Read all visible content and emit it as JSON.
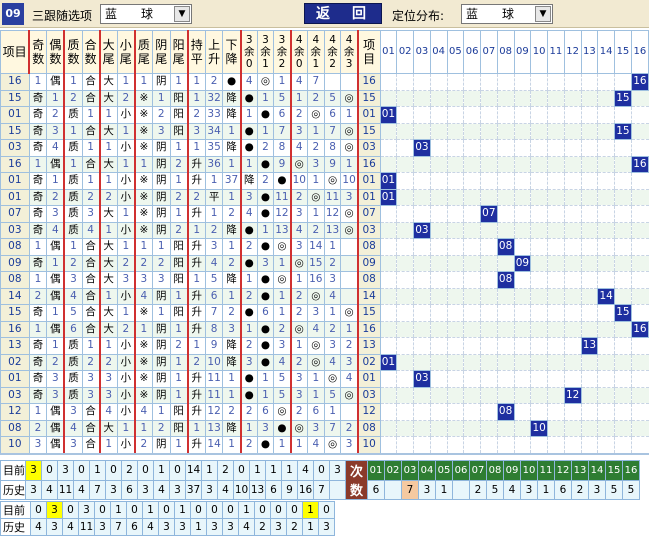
{
  "header": {
    "issue": "09",
    "follow_label": "三跟随选项",
    "follow_value": "蓝　　球",
    "back_label": "返　回",
    "position_label": "定位分布:",
    "position_value": "蓝　　球"
  },
  "columns": [
    "项目",
    "奇数",
    "偶数",
    "质数",
    "合数",
    "大尾",
    "小尾",
    "质尾",
    "阴尾",
    "阳尾",
    "持平",
    "上升",
    "下降",
    "3余0",
    "3余1",
    "3余2",
    "4余0",
    "4余1",
    "4余2",
    "4余3",
    "项目"
  ],
  "num_columns": [
    "01",
    "02",
    "03",
    "04",
    "05",
    "06",
    "07",
    "08",
    "09",
    "10",
    "11",
    "12",
    "13",
    "14",
    "15",
    "16"
  ],
  "rows": [
    {
      "n": "16",
      "c": [
        "1",
        "偶",
        "1",
        "合",
        "大",
        "1",
        "1",
        "阴",
        "1",
        "1",
        "2",
        "●",
        "4",
        "◎",
        "1",
        "4",
        "7"
      ]
    },
    {
      "n": "15",
      "c": [
        "奇",
        "1",
        "2",
        "合",
        "大",
        "2",
        "※",
        "1",
        "阳",
        "1",
        "32",
        "降",
        "●",
        "1",
        "5",
        "1",
        "2",
        "5",
        "◎"
      ]
    },
    {
      "n": "01",
      "c": [
        "奇",
        "2",
        "质",
        "1",
        "1",
        "小",
        "※",
        "2",
        "阳",
        "2",
        "33",
        "降",
        "1",
        "●",
        "6",
        "2",
        "◎",
        "6",
        "1"
      ]
    },
    {
      "n": "15",
      "c": [
        "奇",
        "3",
        "1",
        "合",
        "大",
        "1",
        "※",
        "3",
        "阳",
        "3",
        "34",
        "1",
        "●",
        "1",
        "7",
        "3",
        "1",
        "7",
        "◎"
      ]
    },
    {
      "n": "03",
      "c": [
        "奇",
        "4",
        "质",
        "1",
        "1",
        "小",
        "※",
        "阴",
        "1",
        "1",
        "35",
        "降",
        "●",
        "2",
        "8",
        "4",
        "2",
        "8",
        "◎"
      ]
    },
    {
      "n": "16",
      "c": [
        "1",
        "偶",
        "1",
        "合",
        "大",
        "1",
        "1",
        "阴",
        "2",
        "升",
        "36",
        "1",
        "1",
        "●",
        "9",
        "◎",
        "3",
        "9",
        "1"
      ]
    },
    {
      "n": "01",
      "c": [
        "奇",
        "1",
        "质",
        "1",
        "1",
        "小",
        "※",
        "阴",
        "1",
        "升",
        "1",
        "37",
        "降",
        "2",
        "●",
        "10",
        "1",
        "◎",
        "10",
        "2"
      ]
    },
    {
      "n": "01",
      "c": [
        "奇",
        "2",
        "质",
        "2",
        "2",
        "小",
        "※",
        "阴",
        "2",
        "2",
        "平",
        "1",
        "3",
        "●",
        "11",
        "2",
        "◎",
        "11",
        "3"
      ]
    },
    {
      "n": "07",
      "c": [
        "奇",
        "3",
        "质",
        "3",
        "大",
        "1",
        "※",
        "阴",
        "1",
        "升",
        "1",
        "2",
        "4",
        "●",
        "12",
        "3",
        "1",
        "12",
        "◎"
      ]
    },
    {
      "n": "03",
      "c": [
        "奇",
        "4",
        "质",
        "4",
        "1",
        "小",
        "※",
        "阴",
        "2",
        "1",
        "2",
        "降",
        "●",
        "1",
        "13",
        "4",
        "2",
        "13",
        "◎"
      ]
    },
    {
      "n": "08",
      "c": [
        "1",
        "偶",
        "1",
        "合",
        "大",
        "1",
        "1",
        "1",
        "阳",
        "升",
        "3",
        "1",
        "2",
        "●",
        "◎",
        "3",
        "14",
        "1"
      ]
    },
    {
      "n": "09",
      "c": [
        "奇",
        "1",
        "2",
        "合",
        "大",
        "2",
        "2",
        "2",
        "阳",
        "升",
        "4",
        "2",
        "●",
        "3",
        "1",
        "◎",
        "15",
        "2"
      ]
    },
    {
      "n": "08",
      "c": [
        "1",
        "偶",
        "3",
        "合",
        "大",
        "3",
        "3",
        "3",
        "阳",
        "1",
        "5",
        "降",
        "1",
        "●",
        "◎",
        "1",
        "16",
        "3"
      ]
    },
    {
      "n": "14",
      "c": [
        "2",
        "偶",
        "4",
        "合",
        "1",
        "小",
        "4",
        "阴",
        "1",
        "升",
        "6",
        "1",
        "2",
        "●",
        "1",
        "2",
        "◎",
        "4"
      ]
    },
    {
      "n": "15",
      "c": [
        "奇",
        "1",
        "5",
        "合",
        "大",
        "1",
        "※",
        "1",
        "阳",
        "升",
        "7",
        "2",
        "●",
        "6",
        "1",
        "2",
        "3",
        "1",
        "◎"
      ]
    },
    {
      "n": "16",
      "c": [
        "1",
        "偶",
        "6",
        "合",
        "大",
        "2",
        "1",
        "阴",
        "1",
        "升",
        "8",
        "3",
        "1",
        "●",
        "2",
        "◎",
        "4",
        "2",
        "1"
      ]
    },
    {
      "n": "13",
      "c": [
        "奇",
        "1",
        "质",
        "1",
        "1",
        "小",
        "※",
        "阴",
        "2",
        "1",
        "9",
        "降",
        "2",
        "●",
        "3",
        "1",
        "◎",
        "3",
        "2"
      ]
    },
    {
      "n": "02",
      "c": [
        "奇",
        "2",
        "质",
        "2",
        "2",
        "小",
        "※",
        "阴",
        "1",
        "2",
        "10",
        "降",
        "3",
        "●",
        "4",
        "2",
        "◎",
        "4",
        "3"
      ]
    },
    {
      "n": "01",
      "c": [
        "奇",
        "3",
        "质",
        "3",
        "3",
        "小",
        "※",
        "阴",
        "1",
        "升",
        "11",
        "1",
        "●",
        "1",
        "5",
        "3",
        "1",
        "◎",
        "4"
      ]
    },
    {
      "n": "03",
      "c": [
        "奇",
        "3",
        "质",
        "3",
        "3",
        "小",
        "※",
        "阴",
        "1",
        "升",
        "11",
        "1",
        "●",
        "1",
        "5",
        "3",
        "1",
        "5",
        "◎"
      ]
    },
    {
      "n": "12",
      "c": [
        "1",
        "偶",
        "3",
        "合",
        "4",
        "小",
        "4",
        "1",
        "阳",
        "升",
        "12",
        "2",
        "2",
        "6",
        "◎",
        "2",
        "6",
        "1"
      ]
    },
    {
      "n": "08",
      "c": [
        "2",
        "偶",
        "4",
        "合",
        "大",
        "1",
        "1",
        "2",
        "阳",
        "1",
        "13",
        "降",
        "1",
        "3",
        "●",
        "◎",
        "3",
        "7",
        "2"
      ]
    },
    {
      "n": "10",
      "c": [
        "3",
        "偶",
        "3",
        "合",
        "1",
        "小",
        "2",
        "阴",
        "1",
        "升",
        "14",
        "1",
        "2",
        "●",
        "1",
        "1",
        "4",
        "◎",
        "3"
      ]
    }
  ],
  "hits": [
    "16",
    "15",
    "01",
    "15",
    "03",
    "16",
    "01",
    "01",
    "07",
    "03",
    "08",
    "09",
    "08",
    "14",
    "15",
    "16",
    "13",
    "01",
    "03",
    "12",
    "08",
    "10"
  ],
  "stats": {
    "current_label": "目前",
    "history_label": "历史",
    "current": [
      "3",
      "0",
      "3",
      "0",
      "1",
      "0",
      "2",
      "0",
      "1",
      "0",
      "14",
      "1",
      "2",
      "0",
      "1",
      "1",
      "1",
      "4",
      "0",
      "3"
    ],
    "history": [
      "3",
      "4",
      "11",
      "4",
      "7",
      "3",
      "6",
      "3",
      "4",
      "3",
      "37",
      "3",
      "4",
      "10",
      "13",
      "6",
      "9",
      "16",
      "7"
    ],
    "ci_label": "次数",
    "num_heads": [
      "01",
      "02",
      "03",
      "04",
      "05",
      "06",
      "07",
      "08",
      "09",
      "10",
      "11",
      "12",
      "13",
      "14",
      "15",
      "16"
    ],
    "counts": [
      "6",
      "",
      "7",
      "3",
      "1",
      "",
      "2",
      "5",
      "4",
      "3",
      "1",
      "6",
      "2",
      "3",
      "5",
      "5"
    ]
  },
  "stats2": {
    "current_label": "目前",
    "history_label": "历史",
    "current": [
      "0",
      "3",
      "0",
      "3",
      "0",
      "1",
      "0",
      "1",
      "0",
      "1",
      "0",
      "0",
      "0",
      "1",
      "0",
      "0",
      "0",
      "1",
      "0"
    ],
    "history": [
      "4",
      "3",
      "4",
      "11",
      "3",
      "7",
      "6",
      "4",
      "3",
      "3",
      "1",
      "3",
      "3",
      "4",
      "2",
      "3",
      "2",
      "1",
      "3"
    ]
  }
}
